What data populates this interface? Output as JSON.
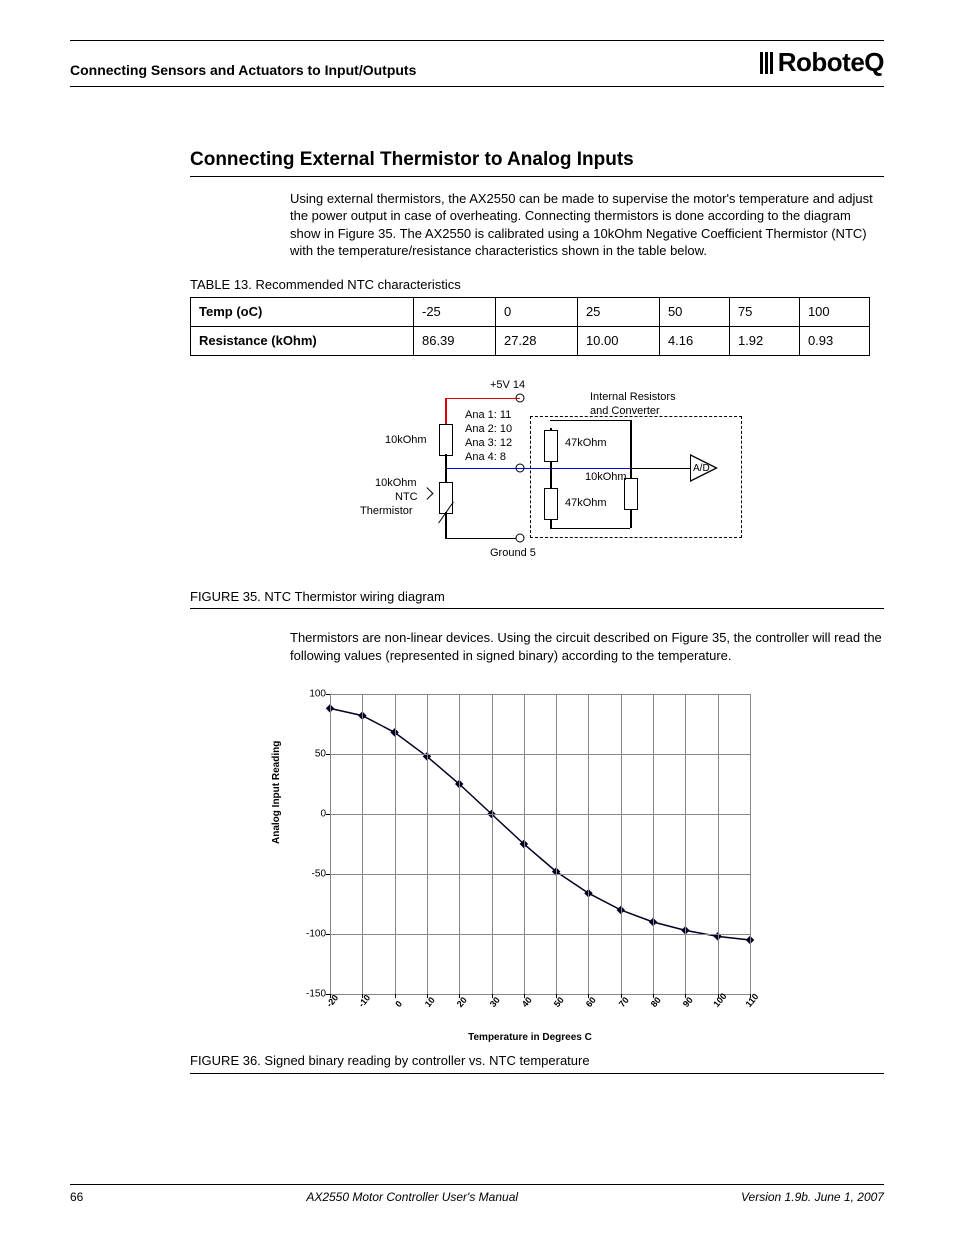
{
  "header": {
    "section": "Connecting Sensors and Actuators to Input/Outputs",
    "logo_text": "RoboteQ"
  },
  "title": "Connecting External Thermistor to Analog Inputs",
  "para1": "Using external thermistors, the AX2550 can be made to supervise the motor's temperature and adjust the power output in case of overheating. Connecting thermistors is done according to the diagram show in Figure 35. The AX2550 is calibrated using a 10kOhm Negative Coefficient Thermistor (NTC) with the temperature/resistance characteristics shown in the table below.",
  "table13": {
    "caption_label": "TABLE 13.",
    "caption_text": "Recommended NTC characteristics",
    "row1_hdr": "Temp (oC)",
    "row2_hdr": "Resistance (kOhm)",
    "temps": [
      "-25",
      "0",
      "25",
      "50",
      "75",
      "100"
    ],
    "res": [
      "86.39",
      "27.28",
      "10.00",
      "4.16",
      "1.92",
      "0.93"
    ]
  },
  "fig35": {
    "caption_label": "FIGURE 35.",
    "caption_text": "NTC Thermistor wiring diagram",
    "top_label": "+5V  14",
    "ana1": "Ana 1:  11",
    "ana2": "Ana 2:  10",
    "ana3": "Ana 3:  12",
    "ana4": "Ana 4:   8",
    "left_res": "10kOhm",
    "left_ntc1": "10kOhm",
    "left_ntc2": "NTC",
    "left_ntc3": "Thermistor",
    "right_hdr1": "Internal Resistors",
    "right_hdr2": "and Converter",
    "r47a": "47kOhm",
    "r47b": "47kOhm",
    "r10": "10kOhm",
    "ad": "A/D",
    "ground": "Ground  5"
  },
  "para2": "Thermistors are non-linear devices. Using the circuit described on Figure 35, the controller will read the following values (represented in signed binary) according to the temperature.",
  "fig36": {
    "caption_label": "FIGURE 36.",
    "caption_text": "Signed binary reading by controller vs. NTC temperature"
  },
  "chart_data": {
    "type": "line",
    "title": "",
    "xlabel": "Temperature in Degrees C",
    "ylabel": "Analog Input Reading",
    "xlim": [
      -20,
      110
    ],
    "ylim": [
      -150,
      100
    ],
    "x_ticks": [
      -20,
      -10,
      0,
      10,
      20,
      30,
      40,
      50,
      60,
      70,
      80,
      90,
      100,
      110
    ],
    "y_ticks": [
      -150,
      -100,
      -50,
      0,
      50,
      100
    ],
    "x": [
      -20,
      -10,
      0,
      10,
      20,
      30,
      40,
      50,
      60,
      70,
      80,
      90,
      100,
      110
    ],
    "values": [
      88,
      82,
      68,
      48,
      25,
      0,
      -25,
      -48,
      -66,
      -80,
      -90,
      -97,
      -102,
      -105
    ]
  },
  "footer": {
    "page": "66",
    "center": "AX2550 Motor Controller User's Manual",
    "right": "Version 1.9b. June 1, 2007"
  }
}
